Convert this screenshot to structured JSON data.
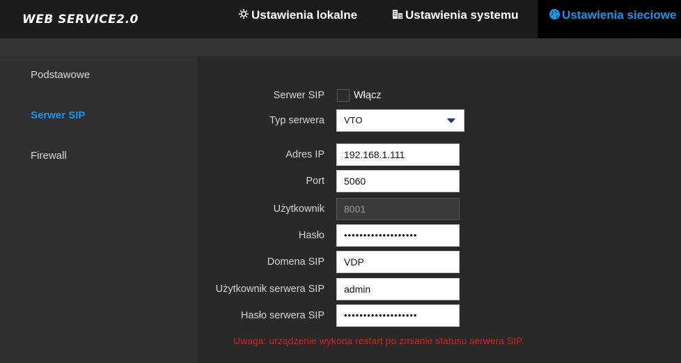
{
  "header": {
    "logo": "WEB SERVICE2.0",
    "tabs": [
      {
        "icon": "gear-icon",
        "label": "Ustawienia lokalne"
      },
      {
        "icon": "building-icon",
        "label": "Ustawienia systemu"
      },
      {
        "icon": "globe-icon",
        "label": "Ustawienia sieciowe"
      }
    ],
    "active_tab": "Ustawienia sieciowe",
    "accent_color": "#1a95e8"
  },
  "sidebar": {
    "items": [
      {
        "label": "Podstawowe"
      },
      {
        "label": "Serwer SIP"
      },
      {
        "label": "Firewall"
      }
    ],
    "active_item": "Serwer SIP"
  },
  "form": {
    "sip_server": {
      "label": "Serwer SIP",
      "checkbox_label": "Włącz",
      "checked": false
    },
    "server_type": {
      "label": "Typ serwera",
      "value": "VTO"
    },
    "ip_address": {
      "label": "Adres IP",
      "value": "192.168.1.111"
    },
    "port": {
      "label": "Port",
      "value": "5060"
    },
    "user": {
      "label": "Użytkownik",
      "value": "8001"
    },
    "password": {
      "label": "Hasło",
      "value": "•••••••••••••••••••"
    },
    "sip_domain": {
      "label": "Domena SIP",
      "value": "VDP"
    },
    "server_user": {
      "label": "Użytkownik serwera SIP",
      "value": "admin"
    },
    "server_password": {
      "label": "Hasło serwera SIP",
      "value": "•••••••••••••••••••"
    }
  },
  "warning": {
    "text": "Uwaga: urządzenie wykona restart po zmianie statusu serwera SIP.",
    "color": "#d0241b"
  }
}
